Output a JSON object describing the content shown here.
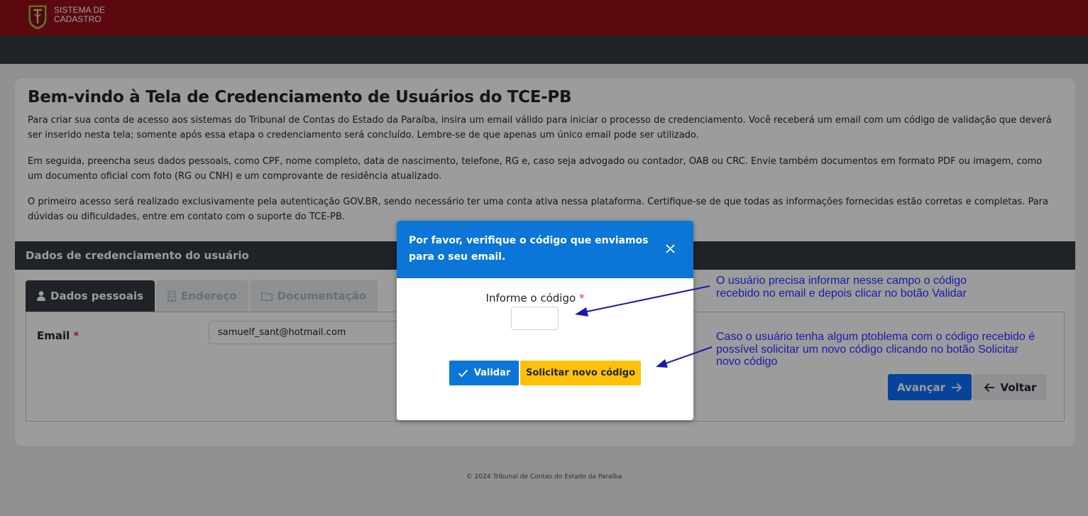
{
  "topbar": {
    "brand_line1": "SISTEMA DE",
    "brand_line2": "CADASTRO",
    "logo_icon": "tce-crest-logo",
    "color": "#950f1a"
  },
  "page": {
    "title": "Bem-vindo à Tela de Credenciamento de Usuários do TCE-PB",
    "paragraphs": [
      "Para criar sua conta de acesso aos sistemas do Tribunal de Contas do Estado da Paraíba, insira um email válido para iniciar o processo de credenciamento. Você receberá um email com um código de validação que deverá ser inserido nesta tela; somente após essa etapa o credenciamento será concluído. Lembre-se de que apenas um único email pode ser utilizado.",
      "Em seguida, preencha seus dados pessoais, como CPF, nome completo, data de nascimento, telefone, RG e, caso seja advogado ou contador, OAB ou CRC. Envie também documentos em formato PDF ou imagem, como um documento oficial com foto (RG ou CNH) e um comprovante de residência atualizado.",
      "O primeiro acesso será realizado exclusivamente pela autenticação GOV.BR, sendo necessário ter uma conta ativa nessa plataforma. Certifique-se de que todas as informações fornecidas estão corretas e completas. Para dúvidas ou dificuldades, entre em contato com o suporte do TCE-PB."
    ]
  },
  "section": {
    "header": "Dados de credenciamento do usuário",
    "tabs": [
      {
        "label": "Dados pessoais",
        "icon": "user-icon",
        "state": "active"
      },
      {
        "label": "Endereço",
        "icon": "building-icon",
        "state": "disabled"
      },
      {
        "label": "Documentação",
        "icon": "folder-icon",
        "state": "disabled"
      }
    ]
  },
  "form": {
    "email_label": "Email",
    "required_mark": "*",
    "email_value": "samuelf_sant@hotmail.com"
  },
  "buttons": {
    "avancar": "Avançar",
    "voltar": "Voltar"
  },
  "footer": {
    "text": "© 2024 Tribunal de Contas do Estado da Paraíba"
  },
  "modal": {
    "title": "Por favor, verifique o código que enviamos para o seu email.",
    "code_label": "Informe o código",
    "required_mark": "*",
    "code_value": "",
    "validar": "Validar",
    "novo_codigo": "Solicitar novo código",
    "header_color": "#0b76d8"
  },
  "annotations": {
    "note1": "O usuário precisa informar nesse campo o código recebido no email e depois clicar no botão Validar",
    "note2": "Caso o usuário tenha algum ptoblema com o código recebido é possível solicitar um novo código clicando no botão Solicitar novo código",
    "color": "#1a1aaa"
  }
}
